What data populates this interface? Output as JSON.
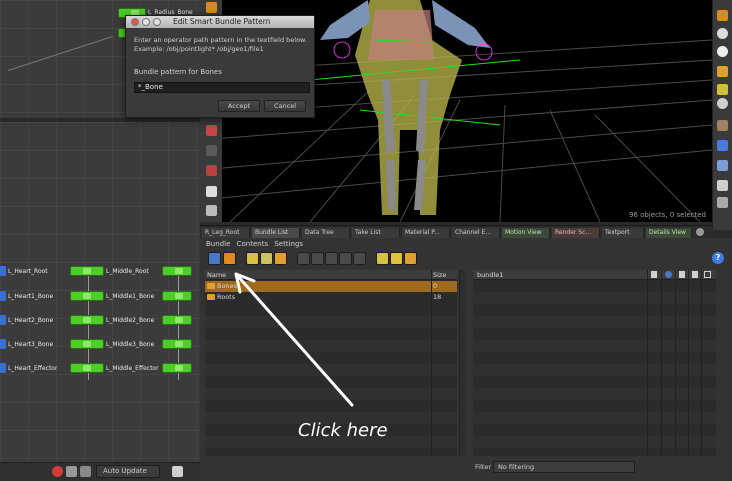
{
  "dialog": {
    "title": "Edit Smart Bundle Pattern",
    "instruction_line1": "Enter an operator path pattern in the textfield below.",
    "instruction_line2": "Example: /obj/pointlight* /obj/geo1/file1",
    "field_label": "Bundle pattern for Bones",
    "field_value": "*_Bone",
    "accept_label": "Accept",
    "cancel_label": "Cancel"
  },
  "network": {
    "nodes": [
      {
        "label": "L_Heart_Root",
        "label2": "L_Middle_Root"
      },
      {
        "label": "L_Heart1_Bone",
        "label2": "L_Middle1_Bone"
      },
      {
        "label": "L_Heart2_Bone",
        "label2": "L_Middle2_Bone"
      },
      {
        "label": "L_Heart3_Bone",
        "label2": "L_Middle3_Bone"
      },
      {
        "label": "L_Heart_Effector",
        "label2": "L_Middle_Effector"
      }
    ],
    "top_node_label": "L_Radius_Bone",
    "auto_update_label": "Auto Update"
  },
  "viewport": {
    "status_text": "96 objects, 0 selected"
  },
  "tabs": [
    {
      "label": "R_Leg_Root"
    },
    {
      "label": "Bundle List"
    },
    {
      "label": "Data Tree"
    },
    {
      "label": "Take List"
    },
    {
      "label": "Material P..."
    },
    {
      "label": "Channel E..."
    },
    {
      "label": "Motion View"
    },
    {
      "label": "Render Sc..."
    },
    {
      "label": "Textport"
    },
    {
      "label": "Details View"
    }
  ],
  "bundle_pane": {
    "menu": [
      "Bundle",
      "Contents",
      "Settings"
    ],
    "left_header_name": "Name",
    "left_header_size": "Size",
    "rows": [
      {
        "name": "Bones",
        "size": "0"
      },
      {
        "name": "Roots",
        "size": "18"
      }
    ],
    "right_header_name": "bundle1",
    "filter_label": "Filter",
    "filter_value": "No filtering",
    "help_label": "?"
  },
  "annotation": {
    "text": "Click here"
  },
  "colors": {
    "selected_row": "#a06a1e",
    "node_green": "#4ccd2a",
    "accent_blue": "#3f7be6"
  }
}
